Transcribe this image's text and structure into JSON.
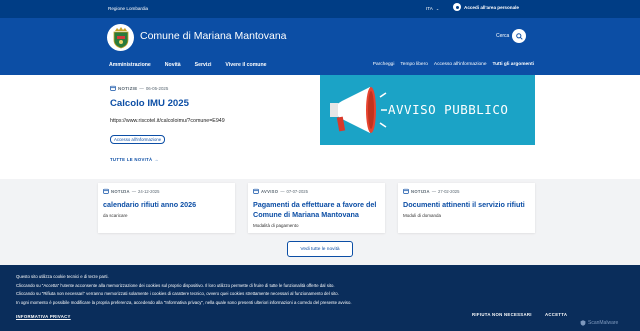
{
  "topbar": {
    "region": "Regione Lombardia",
    "language": "ITA",
    "login": "Accedi all'area personale"
  },
  "header": {
    "title": "Comune di Mariana Mantovana",
    "search_label": "Cerca",
    "main_nav": [
      "Amministrazione",
      "Novità",
      "Servizi",
      "Vivere il comune"
    ],
    "secondary_nav": [
      "Parcheggi",
      "Tempo libero",
      "Accesso all'informazione",
      "Tutti gli argomenti"
    ]
  },
  "featured": {
    "category": "NOTIZIE",
    "date": "06-05-2025",
    "title": "Calcolo IMU 2025",
    "link": "https://www.riscotel.it/calcoloimu/?comune=E949",
    "tag": "Accesso all'informazione",
    "all_news": "TUTTE LE NOVITÀ",
    "banner_text": "AVVISO PUBBLICO"
  },
  "cards": [
    {
      "category": "NOTIZIA",
      "date": "24-12-2025",
      "title": "calendario rifiuti anno 2026",
      "subtitle": "da scaricare"
    },
    {
      "category": "AVVISO",
      "date": "07-07-2025",
      "title": "Pagamenti da effettuare a favore del Comune di Mariana Mantovana",
      "subtitle": "Modalità di pagamento"
    },
    {
      "category": "NOTIZIA",
      "date": "27-02-2025",
      "title": "Documenti attinenti il servizio rifiuti",
      "subtitle": "Moduli di domanda"
    }
  ],
  "see_all": "Vedi tutte le novità",
  "cookie": {
    "lines": [
      "Questo sito utilizza cookie tecnici e di terze parti.",
      "Cliccando su \"Accetta\" l'utente acconsente alla memorizzazione dei cookies sul proprio dispositivo. Il loro utilizzo permette di fruire di tutte le funzionalità offerte dal sito.",
      "Cliccando su \"Rifiuta non necessari\" verranno memorizzati solamente i cookies di carattere tecnico, ovvero quei cookies strettamente necessari al funzionamento del sito.",
      "In ogni momento è possibile modificare la propria preferenza, accedendo alla \"Informativa privacy\", nella quale sono presenti ulteriori informazioni a corredo del presente avviso."
    ],
    "policy": "INFORMATIVA PRIVACY",
    "reject": "RIFIUTA NON NECESSARI",
    "accept": "ACCETTA",
    "watermark": "ScanMalware"
  },
  "colors": {
    "topbar": "#003d85",
    "header": "#0c4ea5",
    "banner": "#1ba3c6",
    "cookie": "#0a2d5b"
  }
}
